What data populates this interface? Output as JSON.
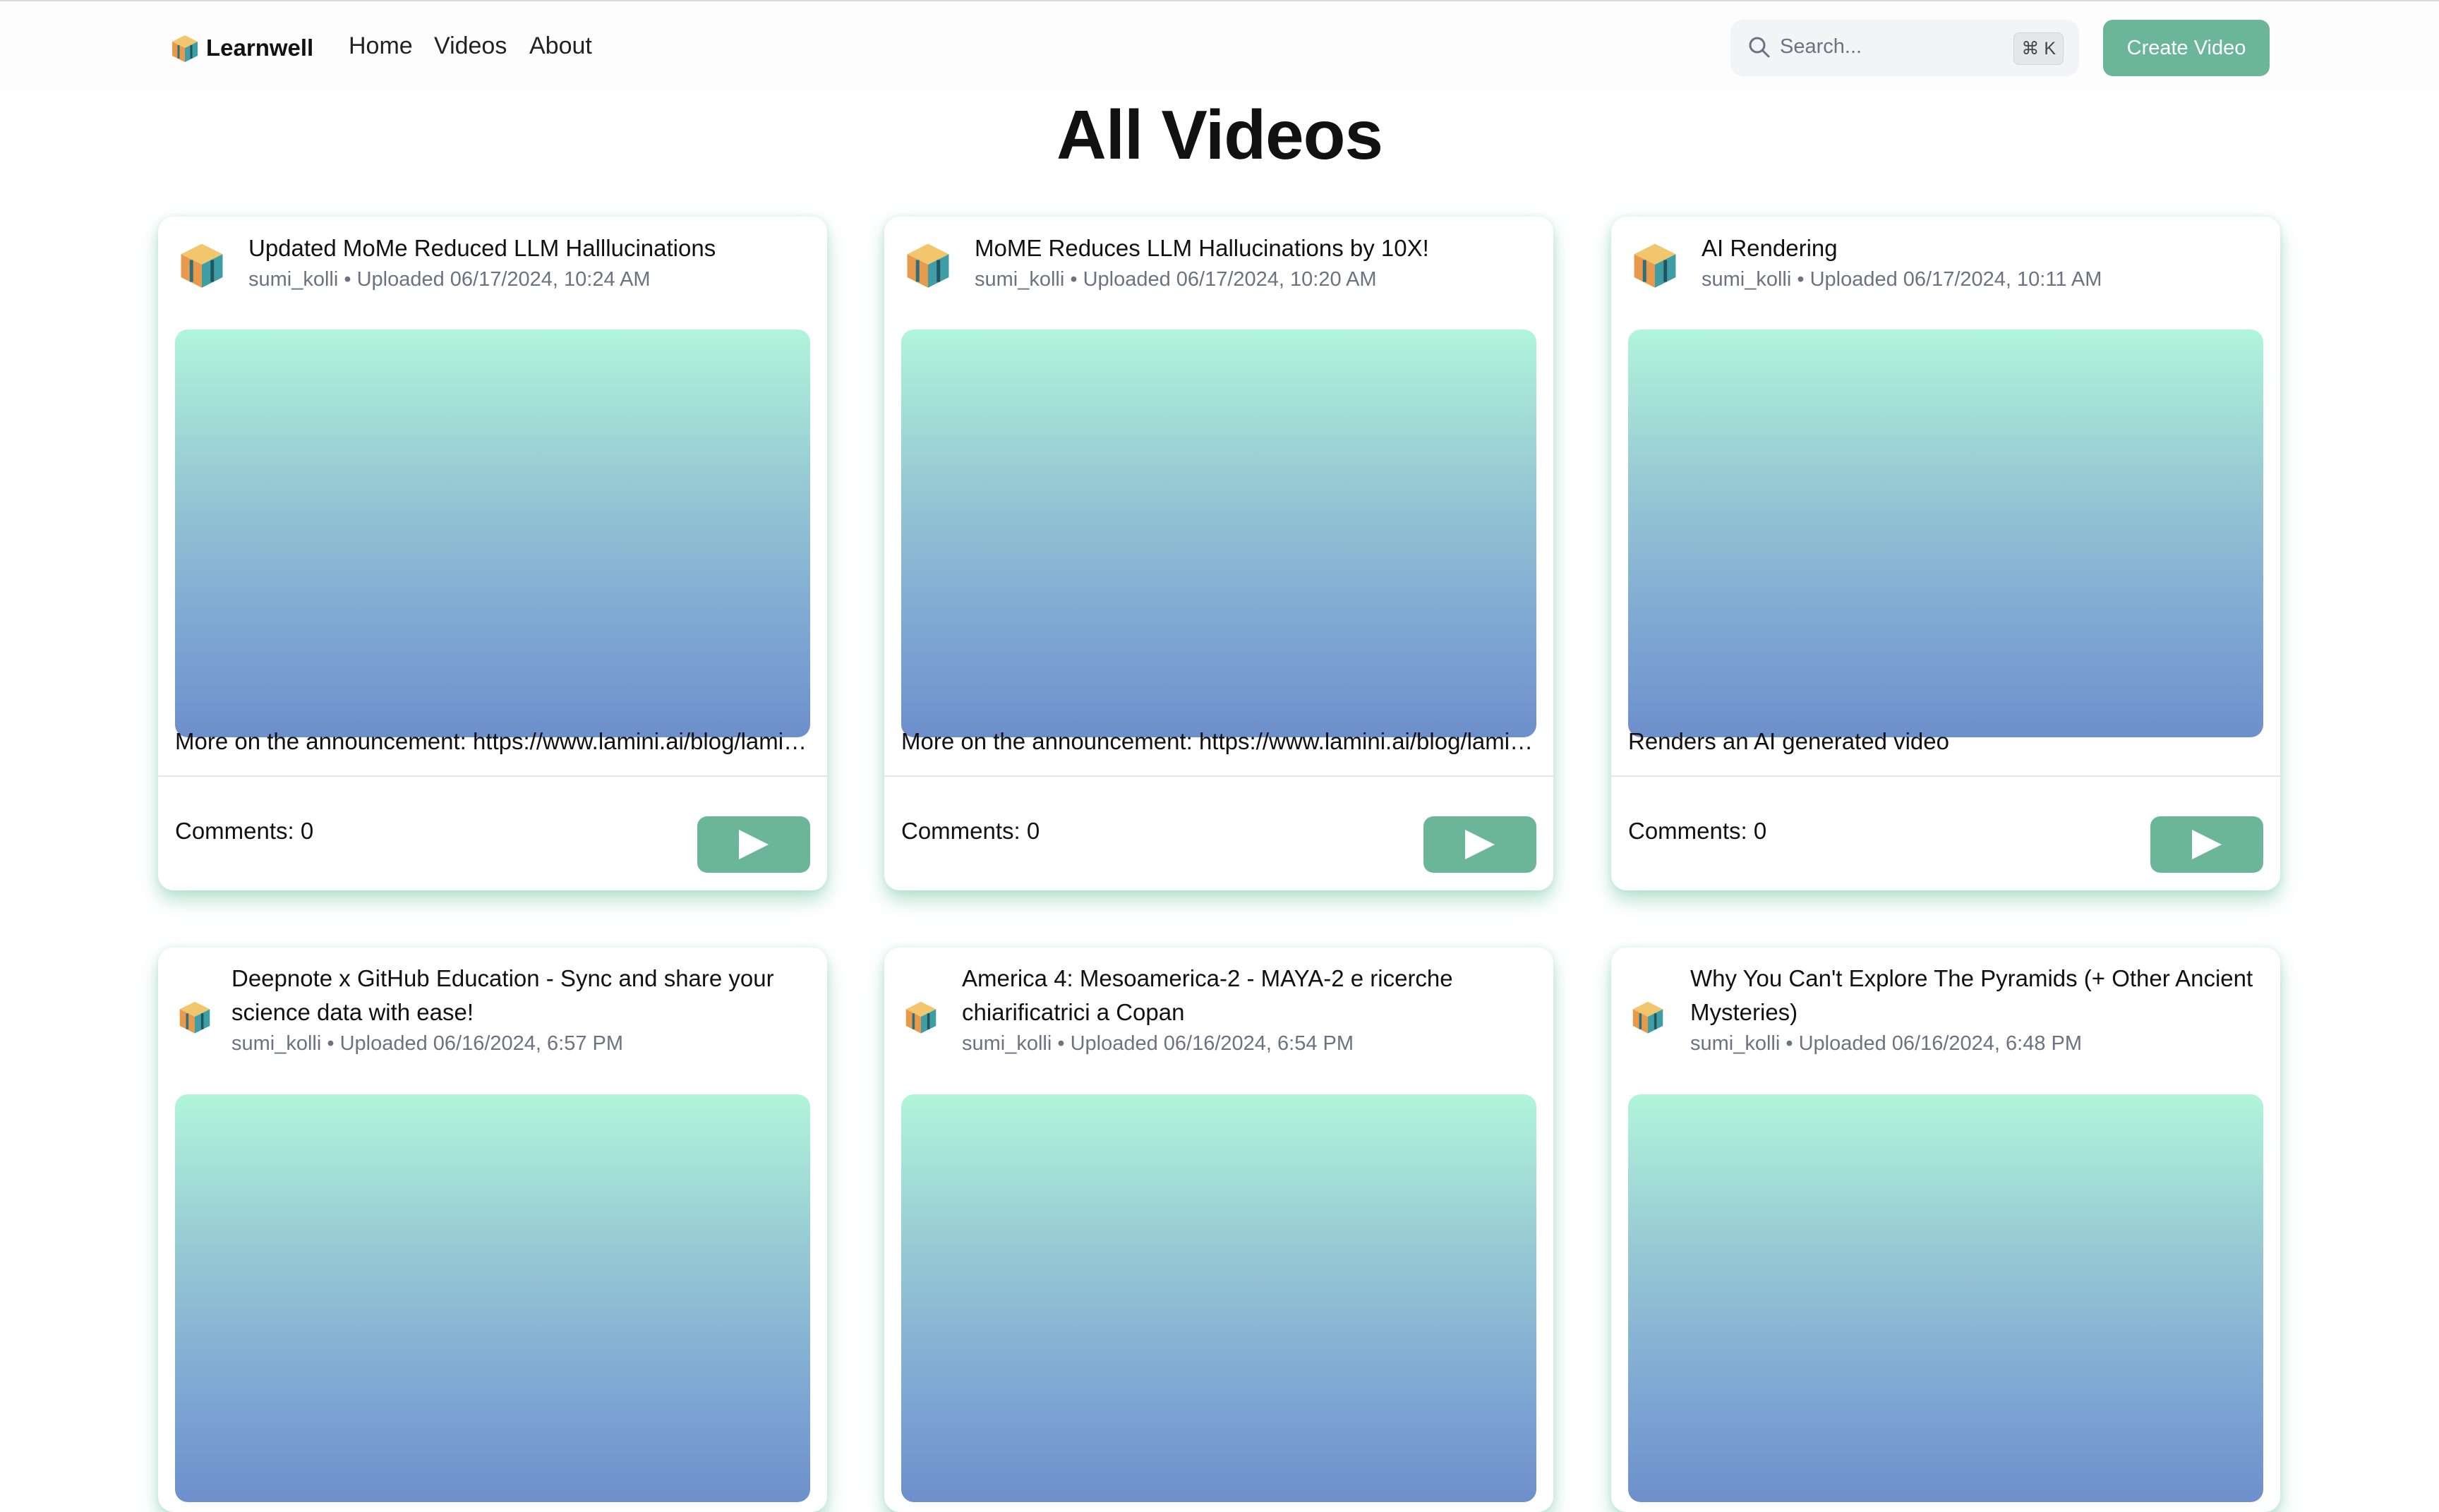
{
  "app": {
    "name": "Learnwell"
  },
  "nav": {
    "links": [
      "Home",
      "Videos",
      "About"
    ]
  },
  "search": {
    "placeholder": "Search...",
    "shortcut": "⌘ K"
  },
  "header": {
    "create_label": "Create Video"
  },
  "page": {
    "title": "All Videos"
  },
  "colors": {
    "accent": "#6bb698",
    "thumb_top": "#b1f5db",
    "thumb_bottom": "#6d8fcc"
  },
  "icons": {
    "logo": "isometric-cube-logo",
    "search": "magnifier-icon",
    "play": "play-icon"
  },
  "videos": [
    {
      "title": "Updated MoMe Reduced LLM Halllucinations",
      "meta": "sumi_kolli • Uploaded 06/17/2024, 10:24 AM",
      "description": "More on the announcement: https://www.lamini.ai/blog/lamini-memory-tuning",
      "comments": "Comments: 0"
    },
    {
      "title": "MoME Reduces LLM Hallucinations by 10X!",
      "meta": "sumi_kolli • Uploaded 06/17/2024, 10:20 AM",
      "description": "More on the announcement: https://www.lamini.ai/blog/lamini-memory-tuning",
      "comments": "Comments: 0"
    },
    {
      "title": "AI Rendering",
      "meta": "sumi_kolli • Uploaded 06/17/2024, 10:11 AM",
      "description": "Renders an AI generated video",
      "comments": "Comments: 0"
    },
    {
      "title": "Deepnote x GitHub Education - Sync and share your science data with ease!",
      "meta": "sumi_kolli • Uploaded 06/16/2024, 6:57 PM"
    },
    {
      "title": "America 4: Mesoamerica-2 - MAYA-2 e ricerche chiarificatrici a Copan",
      "meta": "sumi_kolli • Uploaded 06/16/2024, 6:54 PM"
    },
    {
      "title": "Why You Can't Explore The Pyramids (+ Other Ancient Mysteries)",
      "meta": "sumi_kolli • Uploaded 06/16/2024, 6:48 PM"
    }
  ]
}
